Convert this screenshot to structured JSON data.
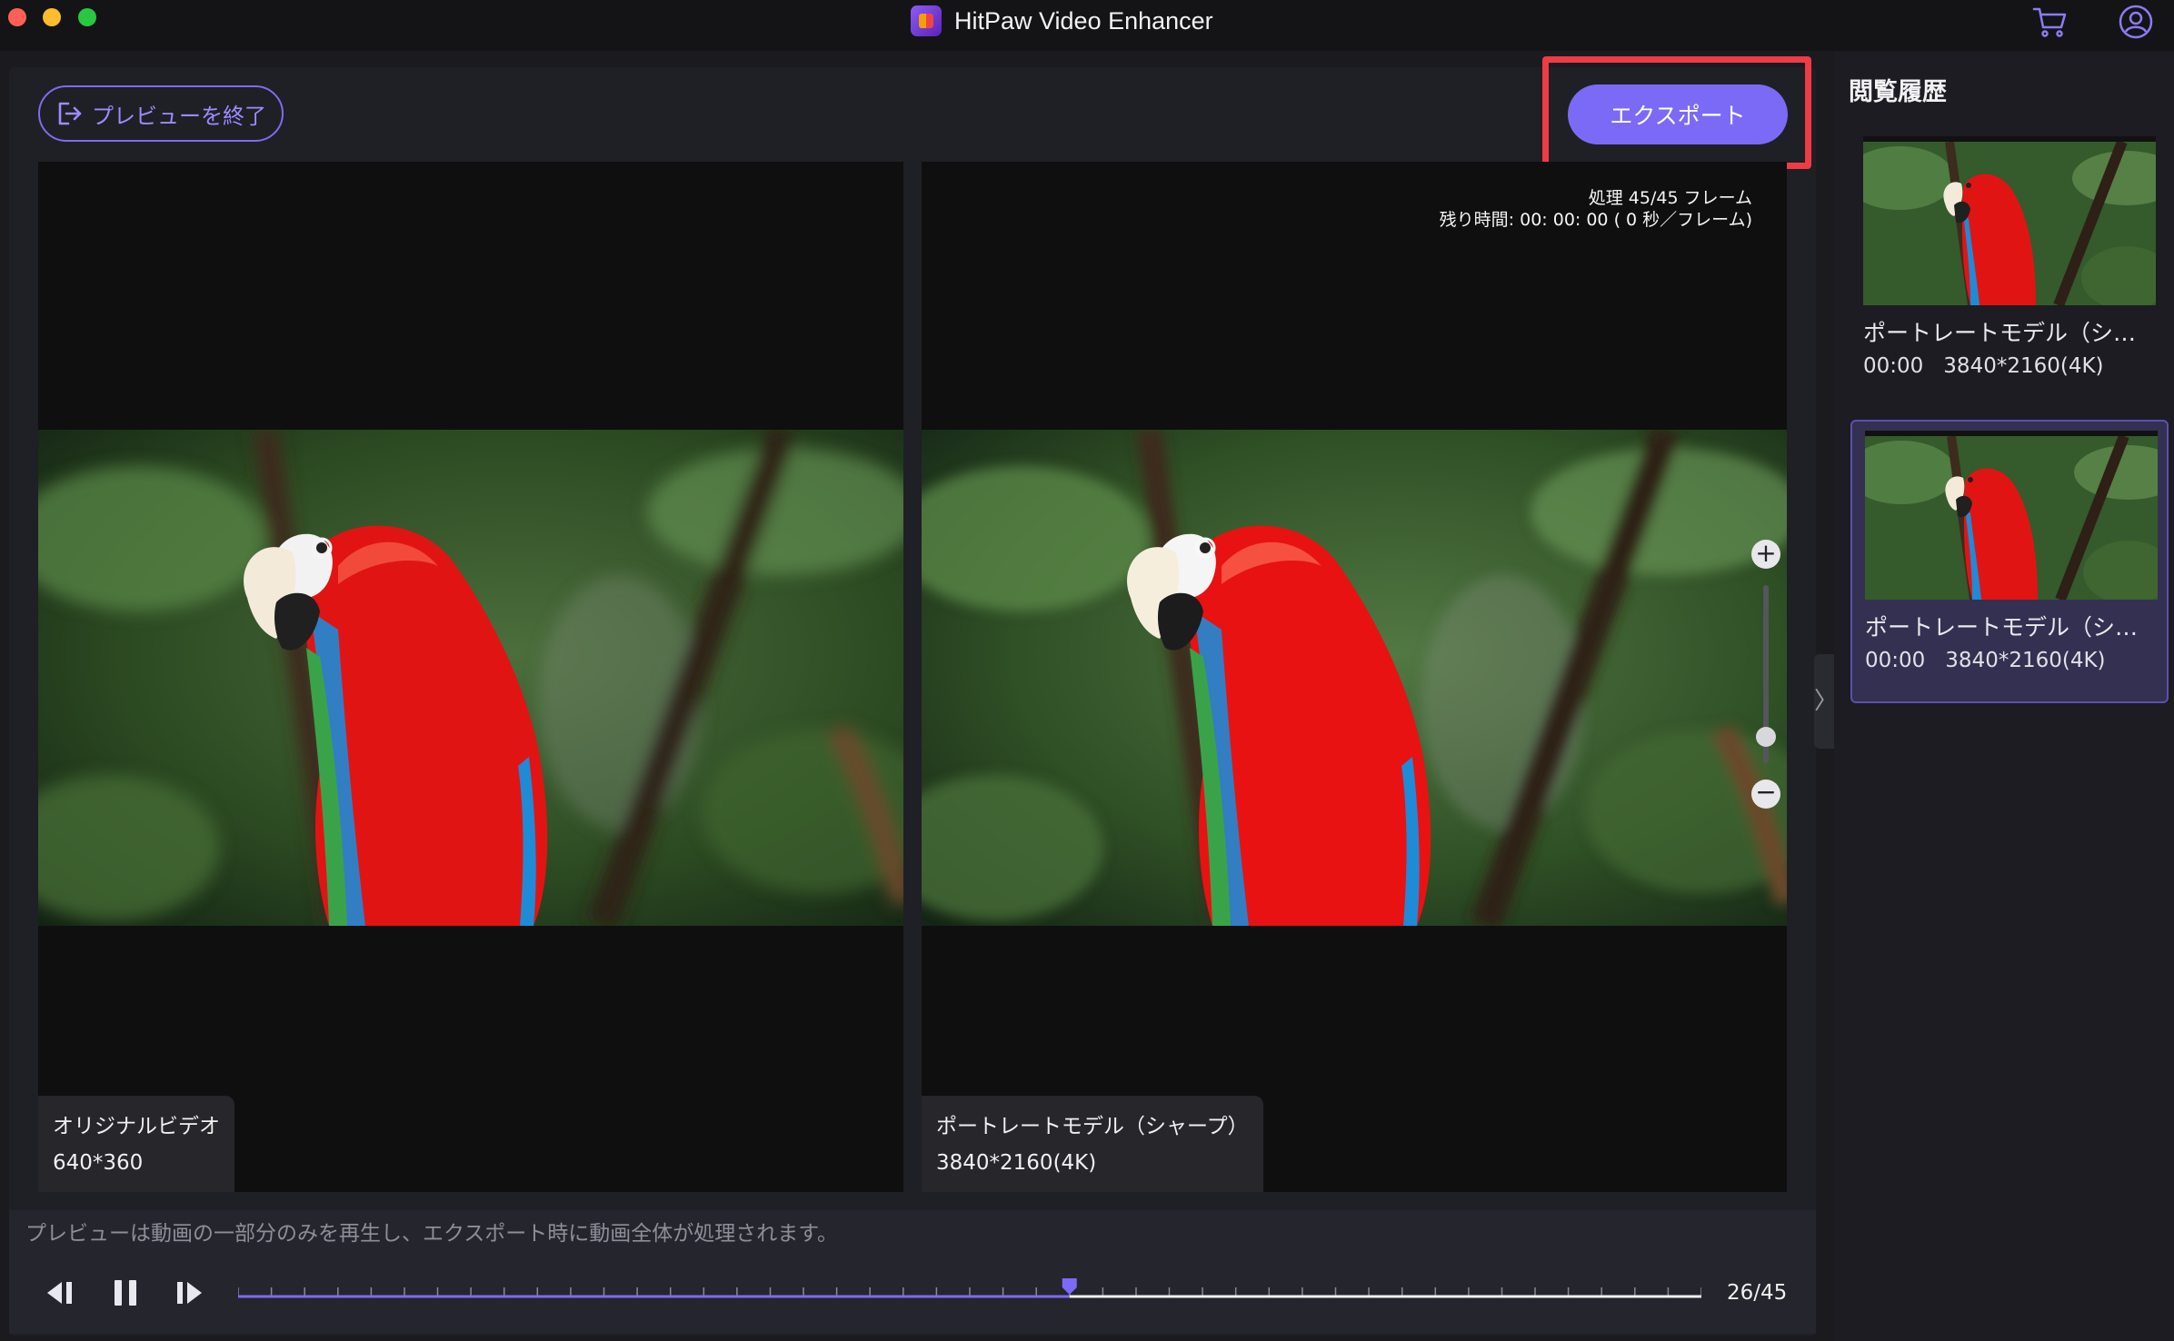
{
  "window": {
    "title": "HitPaw Video Enhancer"
  },
  "toolbar": {
    "exit_preview_label": "プレビューを終了",
    "export_label": "エクスポート"
  },
  "panes": {
    "original": {
      "name": "オリジナルビデオ",
      "resolution": "640*360"
    },
    "enhanced": {
      "name": "ポートレートモデル（シャープ）",
      "resolution": "3840*2160(4K)",
      "progress_frames": "処理 45/45 フレーム",
      "remaining_time": "残り時間: 00: 00: 00 ( 0 秒／フレーム)"
    }
  },
  "zoom": {
    "in_symbol": "+",
    "out_symbol": "−",
    "level": 0.15
  },
  "playback": {
    "note": "プレビューは動画の一部分のみを再生し、エクスポート時に動画全体が処理されます。",
    "current_frame": 26,
    "total_frames": 45,
    "counter": "26/45"
  },
  "sidebar": {
    "title": "閲覧履歴",
    "collapse_symbol": "〉",
    "items": [
      {
        "name": "ポートレートモデル（シャ…",
        "duration": "00:00",
        "resolution": "3840*2160(4K)",
        "selected": false
      },
      {
        "name": "ポートレートモデル（シャ…",
        "duration": "00:00",
        "resolution": "3840*2160(4K)",
        "selected": true
      }
    ]
  },
  "colors": {
    "accent": "#7b6af5",
    "highlight": "#ef3b46",
    "background": "#1a1a1f"
  },
  "icons": {
    "exit": "exit-icon",
    "cart": "cart-icon",
    "account": "account-icon",
    "prev_frame": "prev-frame-icon",
    "pause": "pause-icon",
    "next_frame": "next-frame-icon"
  }
}
